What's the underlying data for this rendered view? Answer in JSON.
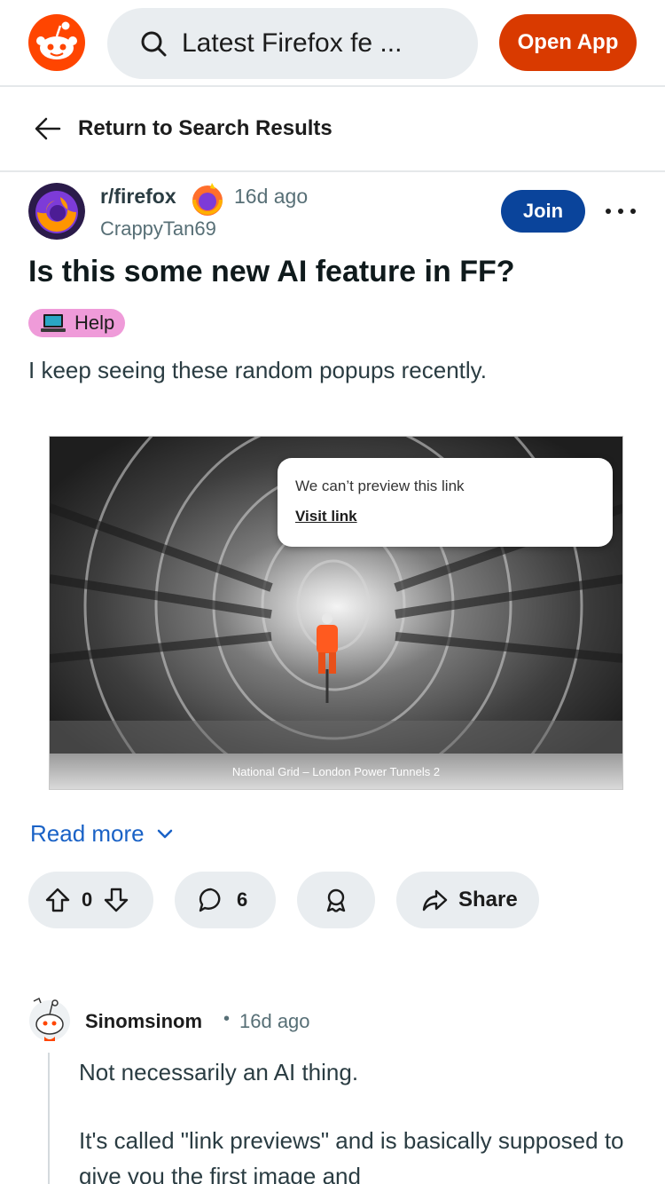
{
  "header": {
    "search_text": "Latest Firefox fe  ...",
    "open_app_label": "Open App",
    "brand_color": "#d93a00",
    "logo_icon": "reddit-snoo-icon",
    "search_icon": "search-icon"
  },
  "returnbar": {
    "label": "Return to Search Results",
    "icon": "arrow-left-icon"
  },
  "post": {
    "subreddit": "r/firefox",
    "time": "16d ago",
    "author": "CrappyTan69",
    "join_label": "Join",
    "join_color": "#0a449b",
    "title": "Is this some new AI feature in FF?",
    "flair": "Help",
    "flair_color": "#ef9bd9",
    "body": "I keep seeing these random popups recently.",
    "image": {
      "preview_message": "We can’t preview this link",
      "preview_link": "Visit link",
      "caption": "National Grid – London Power Tunnels 2"
    },
    "read_more": "Read more",
    "actions": {
      "votes": "0",
      "comments": "6",
      "share_label": "Share"
    }
  },
  "comment": {
    "author": "Sinomsinom",
    "separator": "•",
    "time": "16d ago",
    "line1": "Not necessarily an AI thing.",
    "line2": "It's called \"link previews\" and is basically supposed to give you the first image and"
  }
}
